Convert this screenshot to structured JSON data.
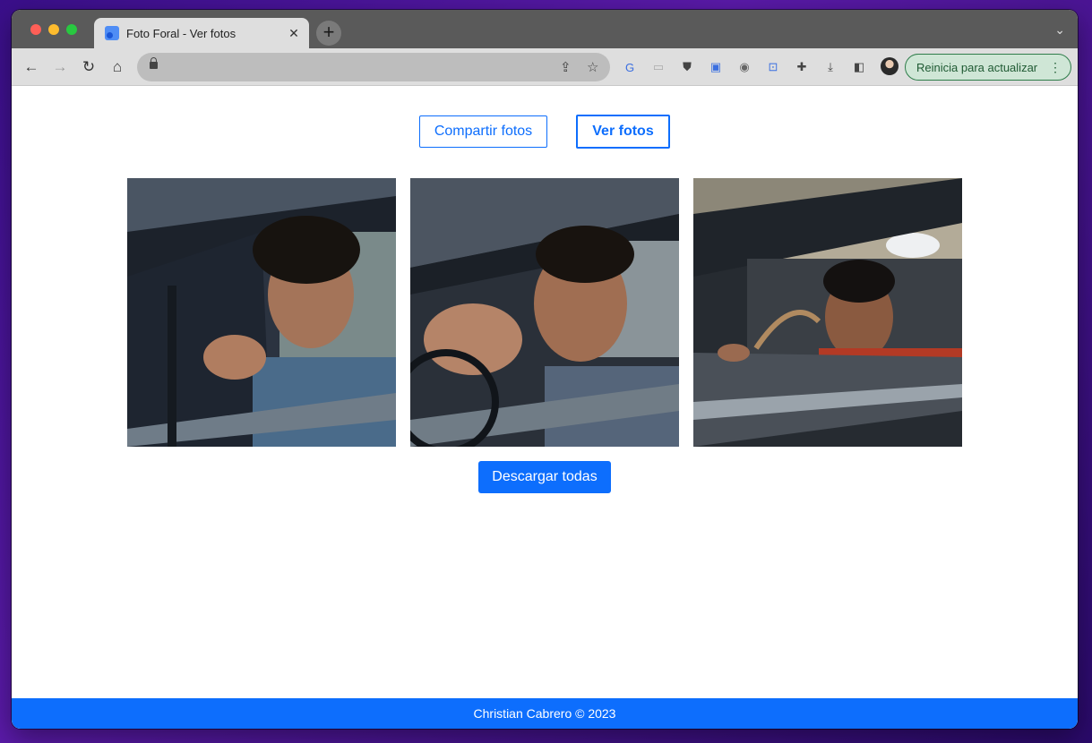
{
  "browser": {
    "tab_title": "Foto Foral - Ver fotos",
    "tab_close": "✕",
    "new_tab": "+",
    "update_label": "Reinicia para actualizar",
    "update_menu": "⋮"
  },
  "nav": {
    "share_label": "Compartir fotos",
    "view_label": "Ver fotos"
  },
  "gallery": {
    "photos": [
      {
        "alt": "photo-1"
      },
      {
        "alt": "photo-2"
      },
      {
        "alt": "photo-3"
      }
    ],
    "download_label": "Descargar todas"
  },
  "footer": {
    "text": "Christian Cabrero © 2023"
  },
  "colors": {
    "primary": "#0d6efd",
    "update_bg": "#cfe6d6"
  }
}
